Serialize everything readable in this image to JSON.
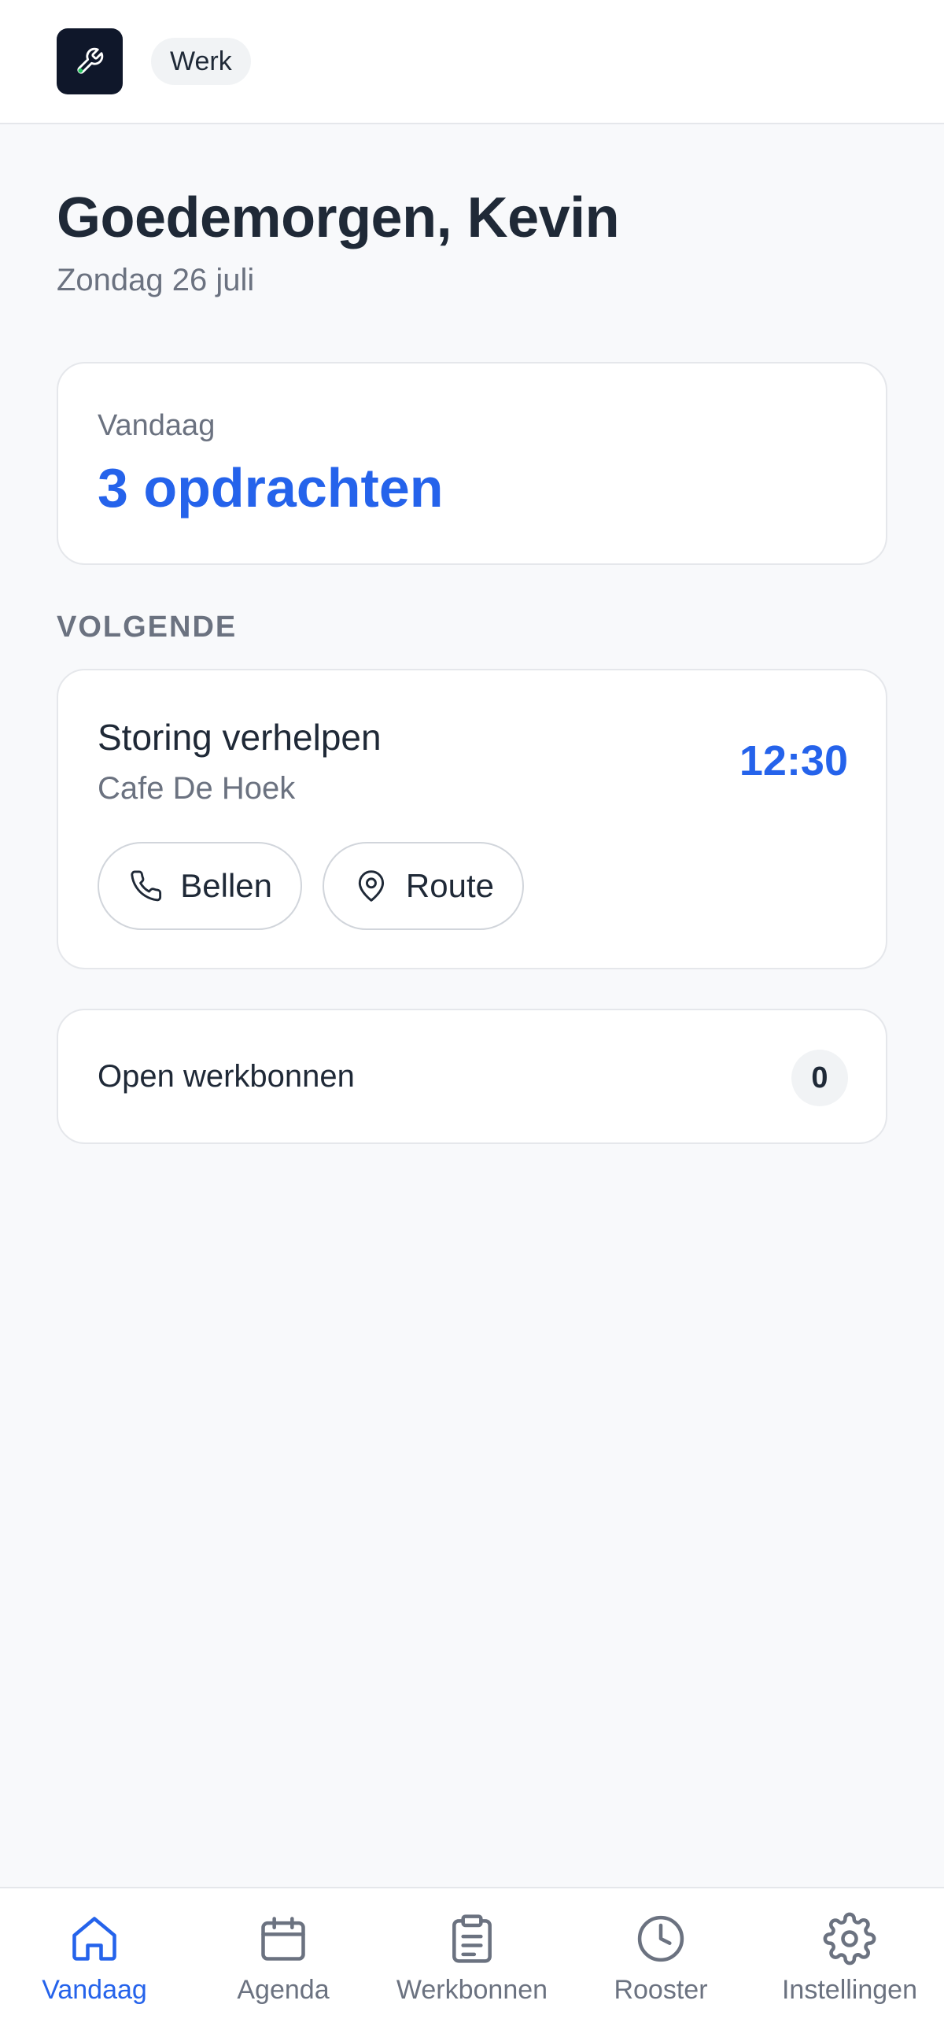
{
  "header": {
    "logo_icon": "wrench-icon",
    "chip_label": "Werk"
  },
  "greeting": {
    "title": "Goedemorgen, Kevin",
    "date": "Zondag 26 juli"
  },
  "today": {
    "label": "Vandaag",
    "count_text": "3 opdrachten"
  },
  "next": {
    "section_title": "VOLGENDE",
    "job_title": "Storing verhelpen",
    "client": "Cafe De Hoek",
    "time": "12:30",
    "call_label": "Bellen",
    "call_icon": "phone-icon",
    "route_label": "Route",
    "route_icon": "map-pin-icon"
  },
  "open_orders": {
    "label": "Open werkbonnen",
    "count": "0"
  },
  "nav": {
    "active": "Vandaag",
    "items": [
      {
        "label": "Vandaag",
        "icon": "home-icon"
      },
      {
        "label": "Agenda",
        "icon": "calendar-icon"
      },
      {
        "label": "Werkbonnen",
        "icon": "clipboard-icon"
      },
      {
        "label": "Rooster",
        "icon": "clock-icon"
      },
      {
        "label": "Instellingen",
        "icon": "gear-icon"
      }
    ]
  },
  "colors": {
    "accent": "#2563eb",
    "logo_bg": "#0f172a",
    "logo_icon": "#22c55e",
    "background": "#f8f9fb",
    "muted_text": "#6b7280"
  }
}
